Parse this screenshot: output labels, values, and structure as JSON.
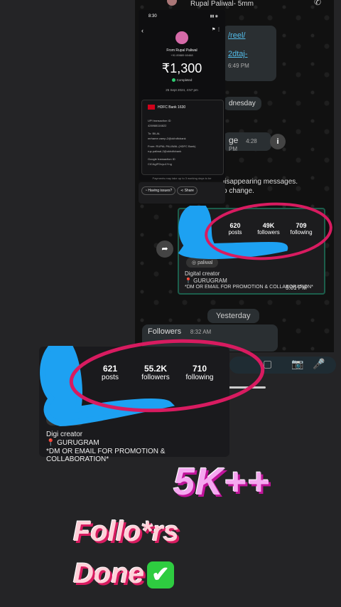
{
  "whatsapp": {
    "contact": "Rupal Paliwal- 5mm",
    "link1": "/reel/",
    "link2": "2dtaj-",
    "time1": "6:49 PM",
    "day_wed": "dnesday",
    "msg_end": "ge",
    "time2": "4:28 PM",
    "disappearing_1": "lisappearing messages.",
    "disappearing_2": "o change.",
    "yesterday": "Yesterday",
    "followers_msg": "Followers",
    "time3": "8:32 AM"
  },
  "receipt": {
    "status_time": "8:30",
    "from": "From Rupal Paliwal",
    "phone": "+91 89889 60468",
    "amount": "₹1,300",
    "status": "Completed",
    "date": "25 Sept 2024, 4:57 pm",
    "bank": "HDFC Bank 1630",
    "upi_label": "UPI transaction ID",
    "upi_value": "426988116822",
    "to_label": "To: BILAL",
    "to_value": "mrhame.vamp-2@okhdfcbank",
    "from_label": "From: RUPAL PALIWAL (HDFC Bank)",
    "from_value": "rup.paliwal-2@okhdfcbank",
    "google_label": "Google transaction ID",
    "google_value": "CICAgIFDvyu1Yng",
    "footer": "Payments may take up to 3 working days to be",
    "btn_issue": "Having issues?",
    "btn_share": "Share"
  },
  "insta_back": {
    "posts_n": "620",
    "posts_l": "posts",
    "followers_n": "49K",
    "followers_l": "followers",
    "following_n": "709",
    "following_l": "following",
    "tag": "paliwal",
    "role": "Digital creator",
    "location": "📍 GURUGRAM",
    "bio": "*DM OR EMAIL FOR PROMOTION & COLLABORATION*",
    "time": "5:01 PM"
  },
  "insta_front": {
    "posts_n": "621",
    "posts_l": "posts",
    "followers_n": "55.2K",
    "followers_l": "followers",
    "following_n": "710",
    "following_l": "following",
    "tag": "paliwal",
    "role": "Digi creator",
    "location": "📍 GURUGRAM",
    "bio": "*DM OR EMAIL FOR PROMOTION & COLLABORATION*"
  },
  "stickers": {
    "big": "5K++",
    "line1": "Follo*rs",
    "line2": "Done",
    "check": "✔"
  },
  "colors": {
    "highlight": "#d81b60",
    "scribble": "#1da1f2"
  }
}
